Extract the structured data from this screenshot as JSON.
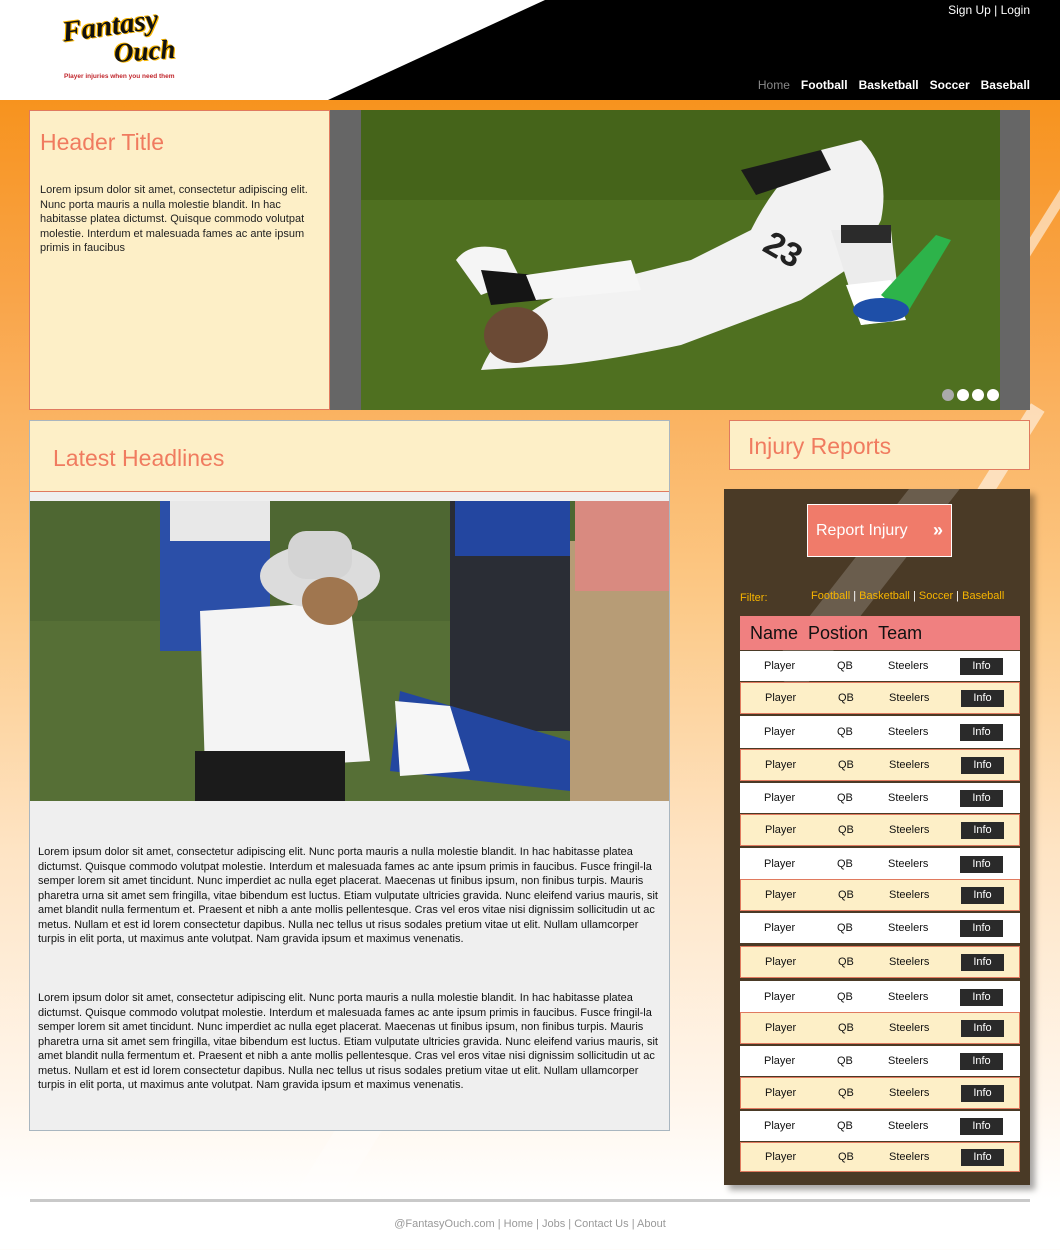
{
  "header": {
    "logo_line1": "Fantasy",
    "logo_line2": "Ouch",
    "logo_tagline": "Player injuries when you need them",
    "auth": {
      "signup": "Sign Up",
      "sep": "|",
      "login": "Login"
    },
    "nav": [
      "Home",
      "Football",
      "Basketball",
      "Soccer",
      "Baseball"
    ]
  },
  "hero": {
    "title": "Header Title",
    "text": "Lorem ipsum dolor sit amet, consectetur adipiscing elit. Nunc porta mauris a nulla molestie blandit. In hac habitasse platea dictumst. Quisque commodo volutpat molestie. Interdum et malesuada fames ac ante ipsum primis in faucibus",
    "slide_count": 4,
    "active_slide": 1
  },
  "headlines": {
    "title": "Latest Headlines",
    "paragraphs": [
      "Lorem ipsum dolor sit amet, consectetur adipiscing elit. Nunc porta mauris a nulla molestie blandit. In hac habitasse platea dictumst. Quisque commodo volutpat molestie. Interdum et malesuada fames ac ante ipsum primis in faucibus. Fusce fringil-la semper lorem sit amet tincidunt. Nunc imperdiet ac nulla eget placerat. Maecenas ut finibus ipsum, non finibus turpis. Mauris pharetra urna sit amet sem fringilla, vitae bibendum est luctus. Etiam vulputate ultricies gravida. Nunc eleifend varius mauris, sit amet blandit nulla fermentum et. Praesent et nibh a ante mollis pellentesque. Cras vel eros vitae nisi dignissim sollicitudin ut ac metus. Nullam et est id lorem consectetur dapibus. Nulla nec tellus ut risus sodales pretium vitae ut elit. Nullam ullamcorper turpis in elit porta, ut maximus ante volutpat. Nam gravida ipsum et maximus venenatis.",
      "Lorem ipsum dolor sit amet, consectetur adipiscing elit. Nunc porta mauris a nulla molestie blandit. In hac habitasse platea dictumst. Quisque commodo volutpat molestie. Interdum et malesuada fames ac ante ipsum primis in faucibus. Fusce fringil-la semper lorem sit amet tincidunt. Nunc imperdiet ac nulla eget placerat. Maecenas ut finibus ipsum, non finibus turpis. Mauris pharetra urna sit amet sem fringilla, vitae bibendum est luctus. Etiam vulputate ultricies gravida. Nunc eleifend varius mauris, sit amet blandit nulla fermentum et. Praesent et nibh a ante mollis pellentesque. Cras vel eros vitae nisi dignissim sollicitudin ut ac metus. Nullam et est id lorem consectetur dapibus. Nulla nec tellus ut risus sodales pretium vitae ut elit. Nullam ullamcorper turpis in elit porta, ut maximus ante volutpat. Nam gravida ipsum et maximus venenatis."
    ]
  },
  "injury": {
    "title": "Injury Reports",
    "report_button": "Report Injury",
    "filter_label": "Filter:",
    "filters": [
      "Football",
      "Basketball",
      "Soccer",
      "Baseball"
    ],
    "columns": [
      "Name",
      "Postion",
      "Team"
    ],
    "rows": [
      {
        "name": "Player",
        "pos": "QB",
        "team": "Steelers",
        "action": "Info"
      },
      {
        "name": "Player",
        "pos": "QB",
        "team": "Steelers",
        "action": "Info"
      },
      {
        "name": "Player",
        "pos": "QB",
        "team": "Steelers",
        "action": "Info"
      },
      {
        "name": "Player",
        "pos": "QB",
        "team": "Steelers",
        "action": "Info"
      },
      {
        "name": "Player",
        "pos": "QB",
        "team": "Steelers",
        "action": "Info"
      },
      {
        "name": "Player",
        "pos": "QB",
        "team": "Steelers",
        "action": "Info"
      },
      {
        "name": "Player",
        "pos": "QB",
        "team": "Steelers",
        "action": "Info"
      },
      {
        "name": "Player",
        "pos": "QB",
        "team": "Steelers",
        "action": "Info"
      },
      {
        "name": "Player",
        "pos": "QB",
        "team": "Steelers",
        "action": "Info"
      },
      {
        "name": "Player",
        "pos": "QB",
        "team": "Steelers",
        "action": "Info"
      },
      {
        "name": "Player",
        "pos": "QB",
        "team": "Steelers",
        "action": "Info"
      },
      {
        "name": "Player",
        "pos": "QB",
        "team": "Steelers",
        "action": "Info"
      },
      {
        "name": "Player",
        "pos": "QB",
        "team": "Steelers",
        "action": "Info"
      },
      {
        "name": "Player",
        "pos": "QB",
        "team": "Steelers",
        "action": "Info"
      },
      {
        "name": "Player",
        "pos": "QB",
        "team": "Steelers",
        "action": "Info"
      },
      {
        "name": "Player",
        "pos": "QB",
        "team": "Steelers",
        "action": "Info"
      }
    ]
  },
  "footer": {
    "links": [
      "@FantasyOuch.com",
      "Home",
      "Jobs",
      "Contact Us",
      "About"
    ]
  },
  "colors": {
    "accent_orange": "#f7931e",
    "salmon": "#f07b5f",
    "cream": "#fdefc7",
    "panel_brown": "#4a3a26",
    "gold": "#f7b500"
  }
}
